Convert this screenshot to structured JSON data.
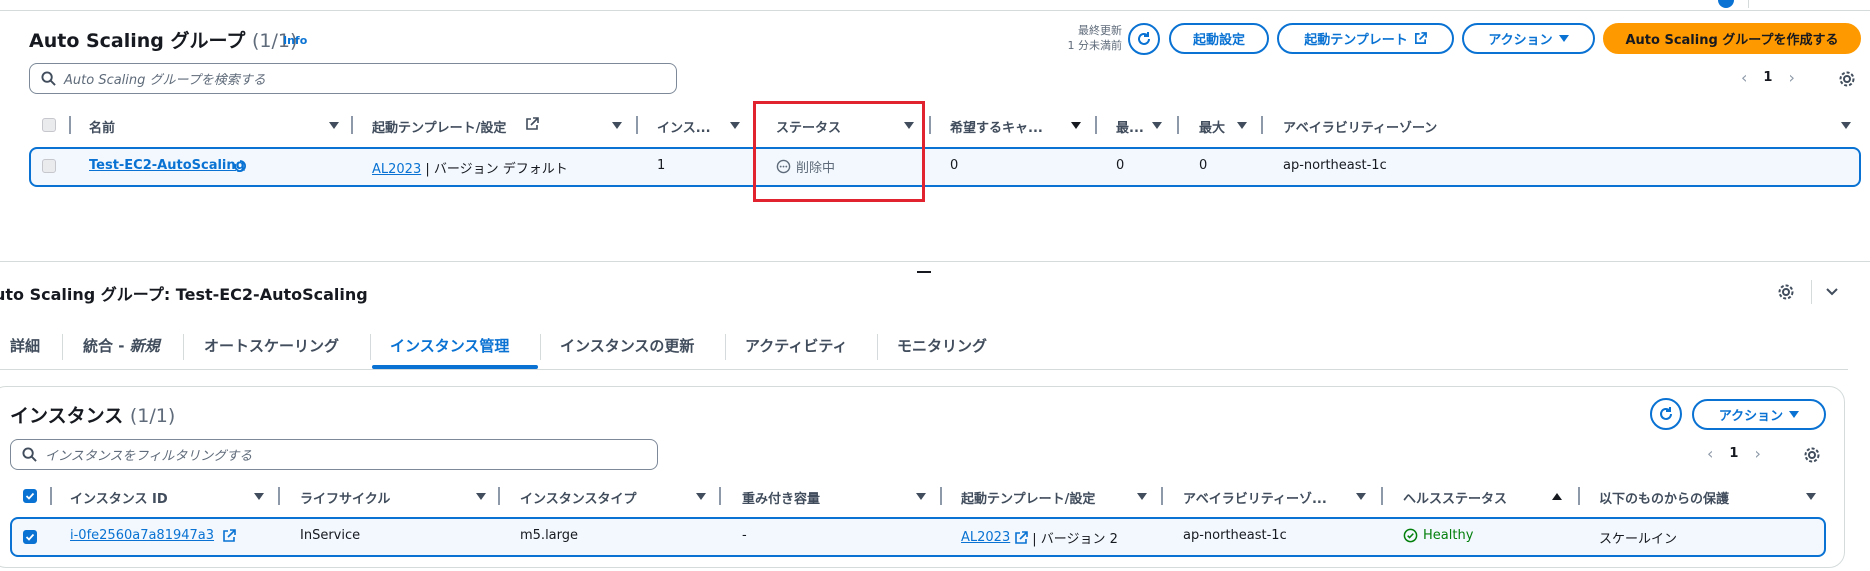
{
  "header": {
    "title": "Auto Scaling グループ",
    "count": "(1/1)",
    "info": "Info",
    "last_updated_line1": "最終更新",
    "last_updated_line2": "1 分未満前",
    "buttons": {
      "launch_config": "起動設定",
      "launch_template": "起動テンプレート",
      "actions": "アクション",
      "create": "Auto Scaling グループを作成する"
    },
    "search_placeholder": "Auto Scaling グループを検索する",
    "page": "1"
  },
  "asg_table": {
    "columns": [
      "名前",
      "起動テンプレート/設定",
      "インス...",
      "ステータス",
      "希望するキャ...",
      "最...",
      "最大",
      "アベイラビリティーゾーン"
    ],
    "row": {
      "name": "Test-EC2-AutoScaling",
      "template_link": "AL2023",
      "template_rest": " | バージョン デフォルト",
      "instances": "1",
      "status": "削除中",
      "desired": "0",
      "min": "0",
      "max": "0",
      "az": "ap-northeast-1c"
    }
  },
  "detail": {
    "title": "uto Scaling グループ: Test-EC2-AutoScaling",
    "tabs": [
      "詳細",
      "統合 - ",
      "新規",
      "オートスケーリング",
      "インスタンス管理",
      "インスタンスの更新",
      "アクティビティ",
      "モニタリング"
    ]
  },
  "instances": {
    "title": "インスタンス",
    "count": "(1/1)",
    "actions": "アクション",
    "search_placeholder": "インスタンスをフィルタリングする",
    "page": "1",
    "columns": [
      "インスタンス ID",
      "ライフサイクル",
      "インスタンスタイプ",
      "重み付き容量",
      "起動テンプレート/設定",
      "アベイラビリティーゾ...",
      "ヘルスステータス",
      "以下のものからの保護"
    ],
    "row": {
      "id": "i-0fe2560a7a81947a3",
      "lifecycle": "InService",
      "type": "m5.large",
      "weight": "-",
      "template_link": "AL2023",
      "template_rest": " | バージョン 2",
      "az": "ap-northeast-1c",
      "health": "Healthy",
      "protection": "スケールイン"
    }
  },
  "colors": {
    "accent": "#0972d3",
    "primary": "#ff9900",
    "highlight": "#e0232e",
    "healthy": "#037f0c"
  }
}
